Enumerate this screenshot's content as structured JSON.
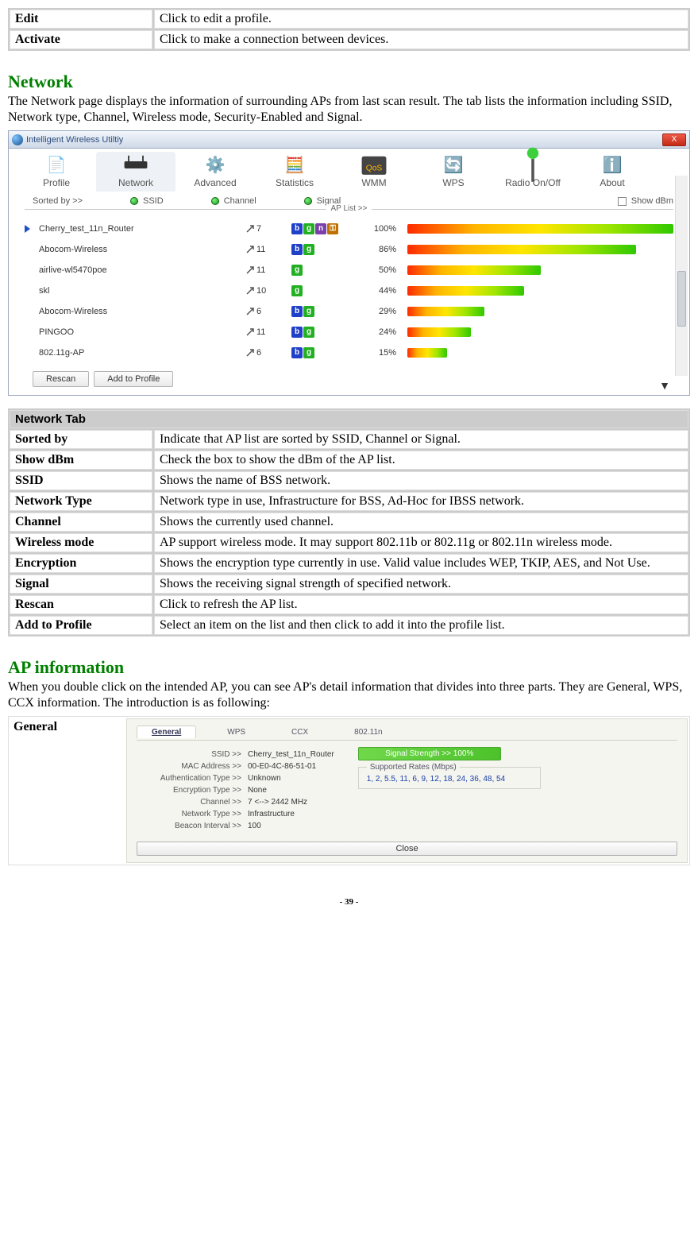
{
  "top_defs": [
    {
      "label": "Edit",
      "desc": "Click to edit a profile."
    },
    {
      "label": "Activate",
      "desc": "Click to make a connection between devices."
    }
  ],
  "network": {
    "heading": "Network",
    "intro": "The Network page displays the information of surrounding APs from last scan result. The tab lists the information including SSID, Network type, Channel, Wireless mode, Security-Enabled and Signal."
  },
  "screenshot": {
    "window_title": "Intelligent Wireless Utiltiy",
    "close_label": "X",
    "toolbar": [
      {
        "label": "Profile"
      },
      {
        "label": "Network",
        "selected": true
      },
      {
        "label": "Advanced"
      },
      {
        "label": "Statistics"
      },
      {
        "label": "WMM"
      },
      {
        "label": "WPS"
      },
      {
        "label": "Radio On/Off"
      },
      {
        "label": "About"
      }
    ],
    "sort_label": "Sorted by >>",
    "sort_options": [
      "SSID",
      "Channel",
      "Signal"
    ],
    "show_dbm_label": "Show dBm",
    "ap_list_label": "AP List >>",
    "aps": [
      {
        "ssid": "Cherry_test_11n_Router",
        "ch": 7,
        "modes": [
          "b",
          "g",
          "n",
          "s"
        ],
        "pct": 100,
        "selected": true
      },
      {
        "ssid": "Abocom-Wireless",
        "ch": 11,
        "modes": [
          "b",
          "g"
        ],
        "pct": 86
      },
      {
        "ssid": "airlive-wl5470poe",
        "ch": 11,
        "modes": [
          "g"
        ],
        "pct": 50
      },
      {
        "ssid": "skl",
        "ch": 10,
        "modes": [
          "g"
        ],
        "pct": 44
      },
      {
        "ssid": "Abocom-Wireless",
        "ch": 6,
        "modes": [
          "b",
          "g"
        ],
        "pct": 29
      },
      {
        "ssid": "PINGOO",
        "ch": 11,
        "modes": [
          "b",
          "g"
        ],
        "pct": 24
      },
      {
        "ssid": "802.11g-AP",
        "ch": 6,
        "modes": [
          "b",
          "g"
        ],
        "pct": 15
      }
    ],
    "buttons": {
      "rescan": "Rescan",
      "add_profile": "Add to Profile"
    }
  },
  "network_tab": {
    "header": "Network Tab",
    "rows": [
      {
        "label": "Sorted by",
        "desc": "Indicate that AP list are sorted by SSID, Channel or Signal."
      },
      {
        "label": "Show dBm",
        "desc": "Check the box to show the dBm of the AP list."
      },
      {
        "label": "SSID",
        "desc": "Shows the name of BSS network."
      },
      {
        "label": "Network Type",
        "desc": "Network type in use, Infrastructure for BSS, Ad-Hoc for IBSS network."
      },
      {
        "label": "Channel",
        "desc": "Shows the currently used channel."
      },
      {
        "label": "Wireless mode",
        "desc": "AP support wireless mode. It may support 802.11b or 802.11g or 802.11n wireless mode."
      },
      {
        "label": "Encryption",
        "desc": "Shows the encryption type currently in use. Valid value includes WEP, TKIP, AES, and Not Use."
      },
      {
        "label": "Signal",
        "desc": "Shows the receiving signal strength of specified network."
      },
      {
        "label": "Rescan",
        "desc": "Click to refresh the AP list."
      },
      {
        "label": "Add to Profile",
        "desc": "Select an item on the list and then click to add it into the profile list."
      }
    ]
  },
  "ap_info": {
    "heading": "AP information",
    "intro": "When you double click on the intended AP, you can see AP's detail information that divides into three parts. They are General, WPS, CCX information. The introduction is as following:",
    "general_label": "General",
    "tabs": [
      "General",
      "WPS",
      "CCX",
      "802.11n"
    ],
    "fields": {
      "ssid_k": "SSID >>",
      "ssid_v": "Cherry_test_11n_Router",
      "mac_k": "MAC Address >>",
      "mac_v": "00-E0-4C-86-51-01",
      "auth_k": "Authentication Type >>",
      "auth_v": "Unknown",
      "enc_k": "Encryption Type >>",
      "enc_v": "None",
      "ch_k": "Channel >>",
      "ch_v": "7 <--> 2442 MHz",
      "nt_k": "Network Type >>",
      "nt_v": "Infrastructure",
      "bi_k": "Beacon Interval >>",
      "bi_v": "100"
    },
    "signal_strength": "Signal Strength >> 100%",
    "rates_title": "Supported Rates (Mbps)",
    "rates_val": "1, 2, 5.5, 11, 6, 9, 12, 18, 24, 36, 48, 54",
    "close": "Close"
  },
  "page_number": "- 39 -"
}
